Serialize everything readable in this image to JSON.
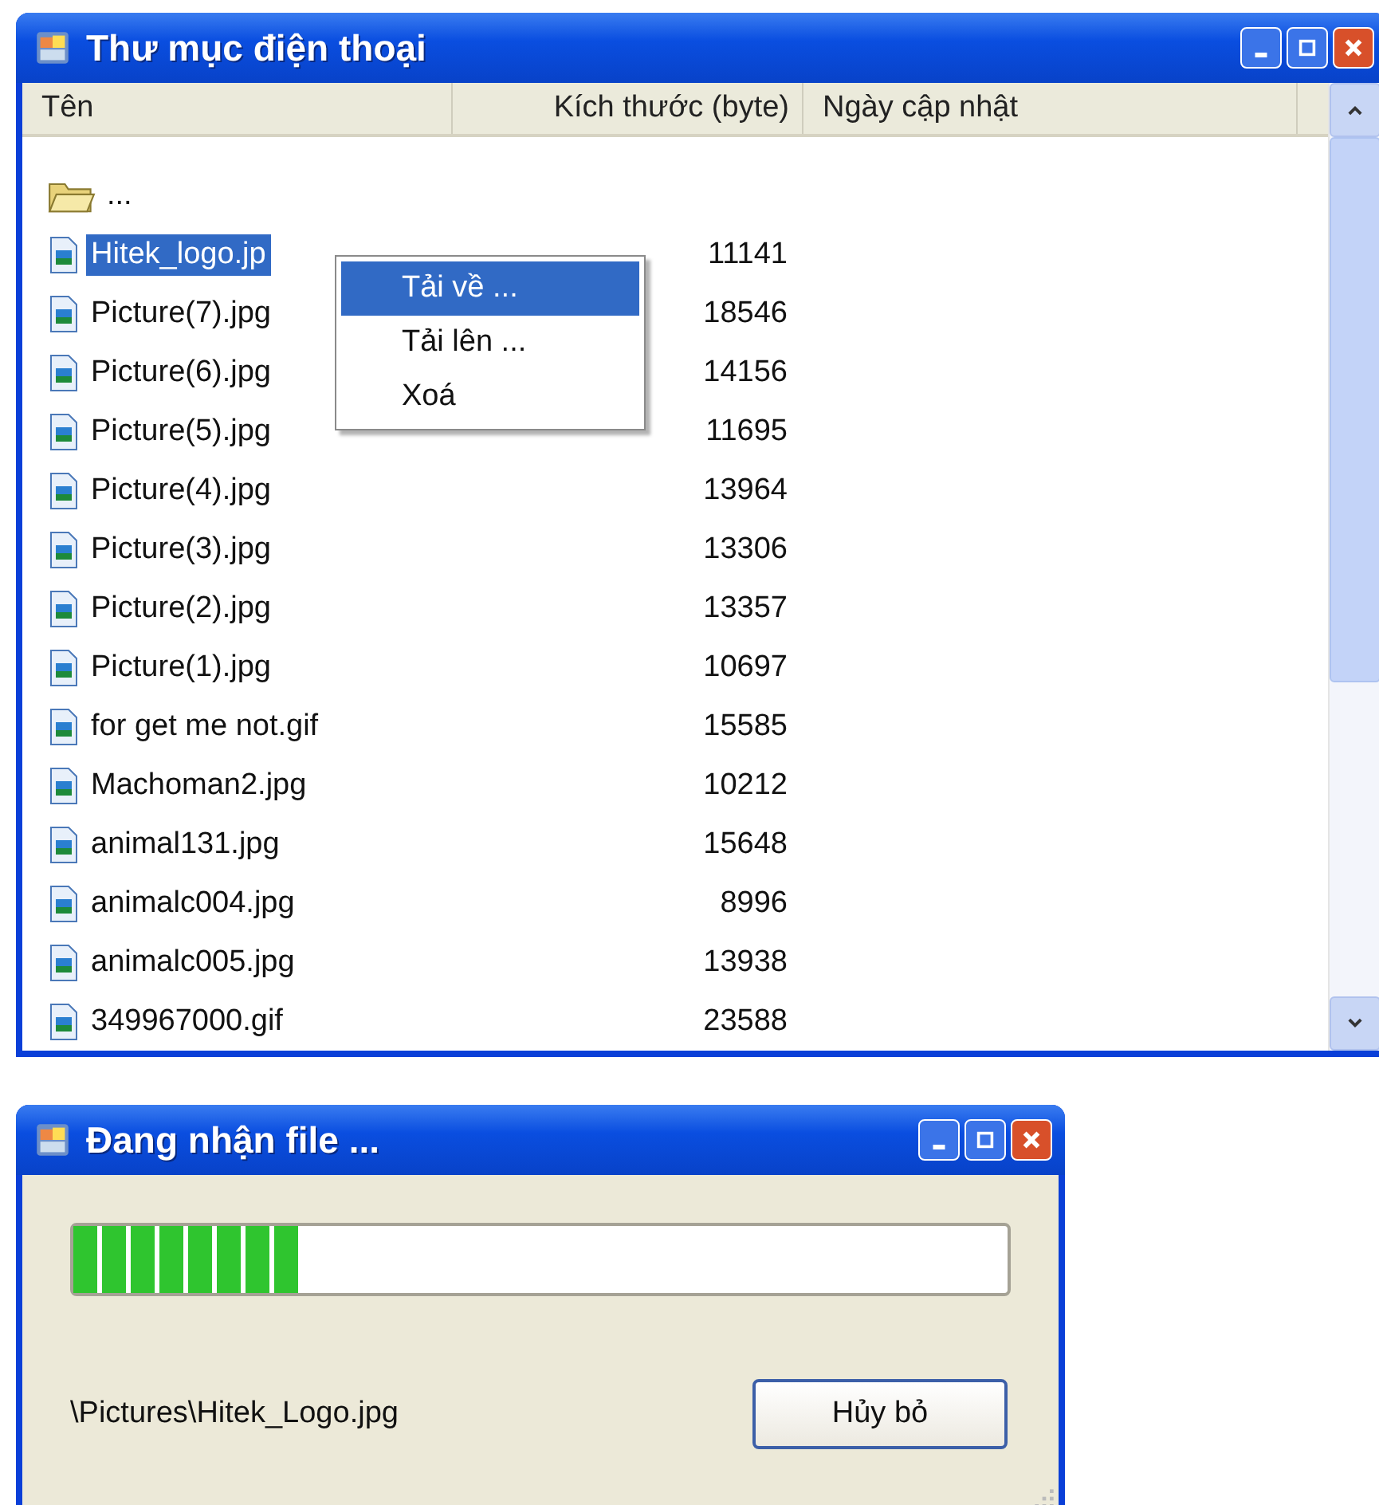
{
  "file_window": {
    "title": "Thư mục điện thoại",
    "columns": [
      "Tên",
      "Kích thước (byte)",
      "Ngày cập nhật"
    ],
    "parent_row": {
      "name": "..."
    },
    "rows": [
      {
        "name": "Hitek_logo.jp",
        "size": "11141",
        "selected": true
      },
      {
        "name": "Picture(7).jpg",
        "size": "18546",
        "selected": false
      },
      {
        "name": "Picture(6).jpg",
        "size": "14156",
        "selected": false
      },
      {
        "name": "Picture(5).jpg",
        "size": "11695",
        "selected": false
      },
      {
        "name": "Picture(4).jpg",
        "size": "13964",
        "selected": false
      },
      {
        "name": "Picture(3).jpg",
        "size": "13306",
        "selected": false
      },
      {
        "name": "Picture(2).jpg",
        "size": "13357",
        "selected": false
      },
      {
        "name": "Picture(1).jpg",
        "size": "10697",
        "selected": false
      },
      {
        "name": "for get me not.gif",
        "size": "15585",
        "selected": false
      },
      {
        "name": "Machoman2.jpg",
        "size": "10212",
        "selected": false
      },
      {
        "name": "animal131.jpg",
        "size": "15648",
        "selected": false
      },
      {
        "name": "animalc004.jpg",
        "size": "8996",
        "selected": false
      },
      {
        "name": "animalc005.jpg",
        "size": "13938",
        "selected": false
      },
      {
        "name": "349967000.gif",
        "size": "23588",
        "selected": false
      }
    ],
    "context_menu": [
      {
        "label": "Tải về ...",
        "selected": true
      },
      {
        "label": "Tải lên ...",
        "selected": false
      },
      {
        "label": "Xoá",
        "selected": false
      }
    ]
  },
  "progress_window": {
    "title": "Đang nhận file ...",
    "progress": {
      "level": 0.24
    },
    "file_path": "\\Pictures\\Hitek_Logo.jpg",
    "cancel_button": "Hủy bỏ"
  }
}
